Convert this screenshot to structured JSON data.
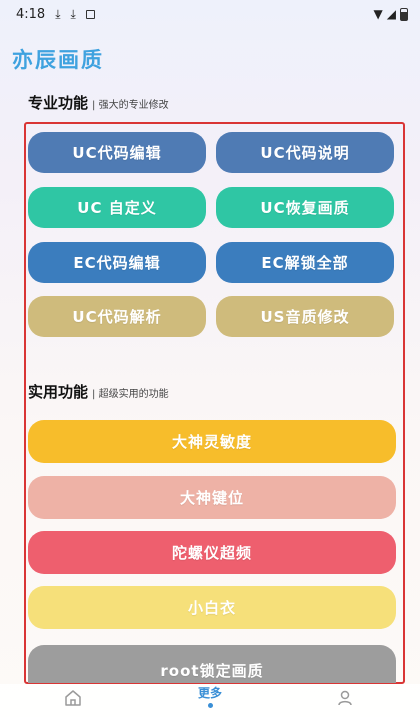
{
  "status_bar": {
    "time": "4:18",
    "icons": [
      "download-icon",
      "download-icon",
      "notification-box-icon"
    ],
    "right_icons": [
      "wifi-icon",
      "signal-icon",
      "battery-icon"
    ]
  },
  "app": {
    "title": "亦辰画质"
  },
  "section_pro": {
    "title": "专业功能",
    "subtitle": "强大的专业修改"
  },
  "pro_buttons": [
    {
      "label": "UC代码编辑",
      "color": "#4f7bb4"
    },
    {
      "label": "UC代码说明",
      "color": "#4f7bb4"
    },
    {
      "label": "UC  自定义",
      "color": "#2fc6a4"
    },
    {
      "label": "UC恢复画质",
      "color": "#2fc6a4"
    },
    {
      "label": "EC代码编辑",
      "color": "#3b7dbe"
    },
    {
      "label": "EC解锁全部",
      "color": "#3b7dbe"
    },
    {
      "label": "UC代码解析",
      "color": "#cfbb7c"
    },
    {
      "label": "US音质修改",
      "color": "#cfbb7c"
    }
  ],
  "section_util": {
    "title": "实用功能",
    "subtitle": "超级实用的功能"
  },
  "util_buttons": [
    {
      "label": "大神灵敏度",
      "color": "#f7bd2b"
    },
    {
      "label": "大神键位",
      "color": "#eeb2a6"
    },
    {
      "label": "陀螺仪超频",
      "color": "#ee5f6e"
    },
    {
      "label": "小白衣",
      "color": "#f6e07a"
    },
    {
      "label": "root锁定画质",
      "color": "#9d9d9d"
    }
  ],
  "bottom_nav": {
    "items": [
      {
        "label": "",
        "icon": "home-icon"
      },
      {
        "label": "更多",
        "icon": "",
        "active": true
      },
      {
        "label": "",
        "icon": "user-icon"
      }
    ],
    "accent": "#3a8fd6"
  }
}
